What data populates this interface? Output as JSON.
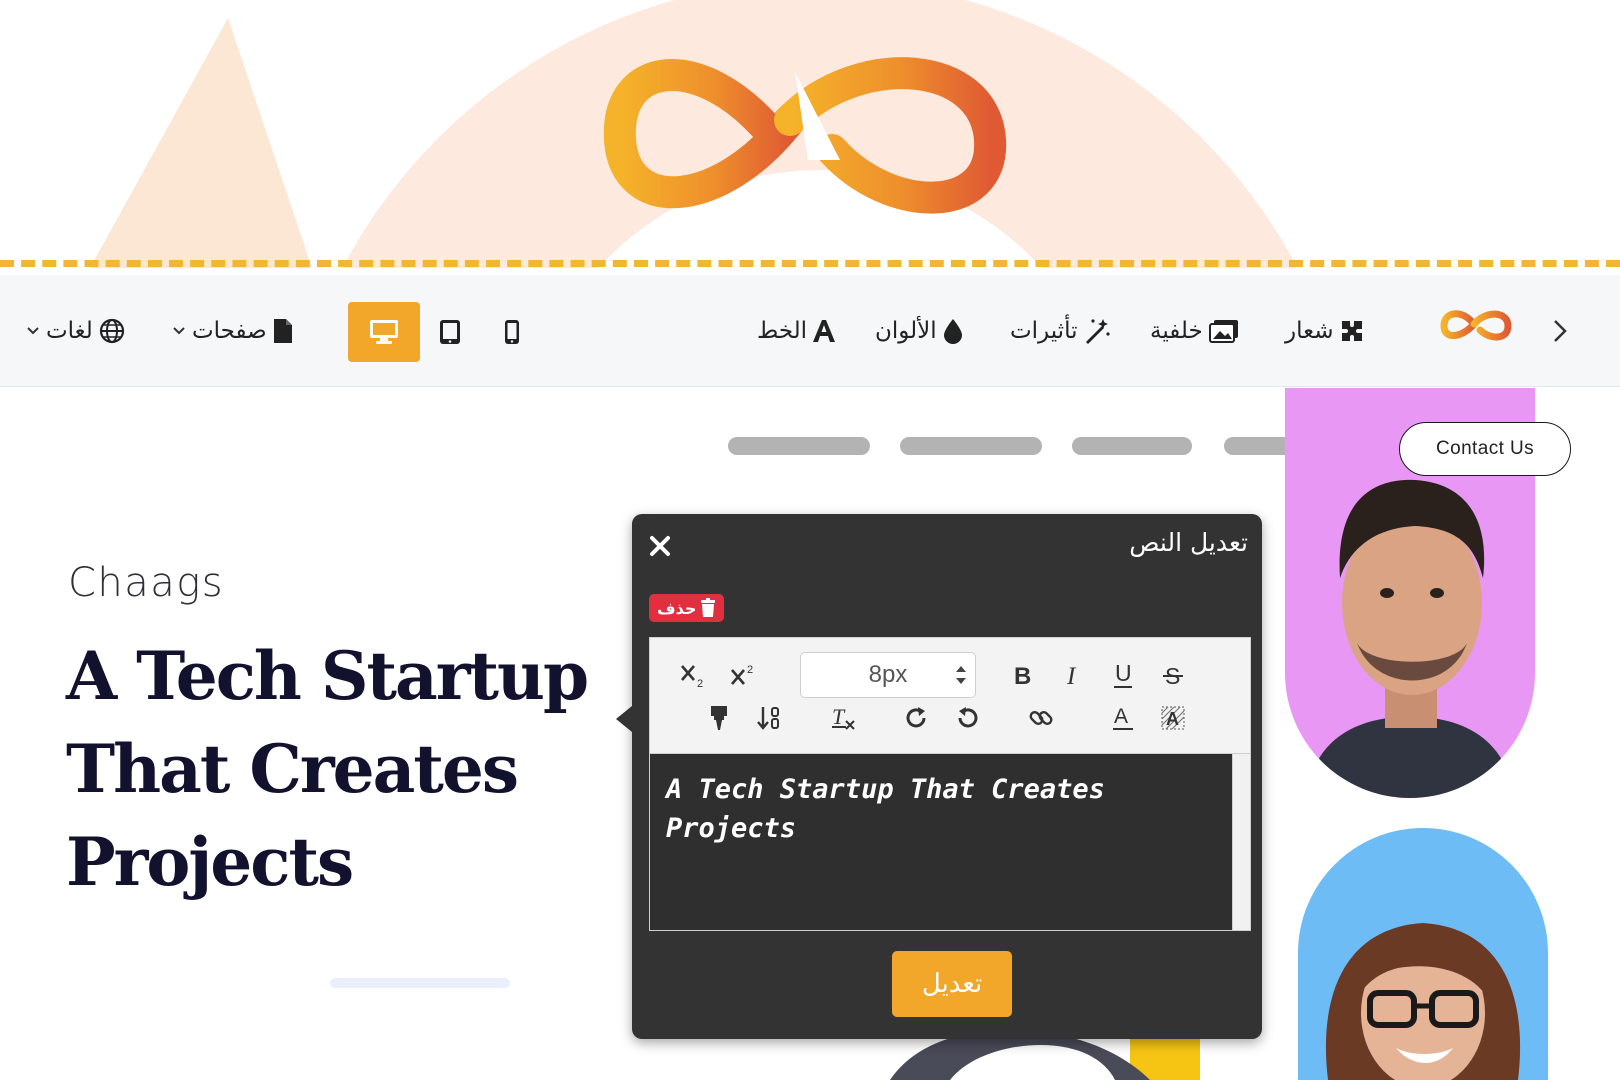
{
  "colors": {
    "accent": "#f2a62a",
    "dialog_bg": "#333333",
    "danger": "#e0303f",
    "heading": "#13122e",
    "purple_card": "#e898f4",
    "blue_card": "#6ebcf5",
    "dash": "#f2b632"
  },
  "toolbar": {
    "nav_icon": "chevron-right-icon",
    "items": [
      {
        "label": "شعار",
        "icon": "puzzle-icon"
      },
      {
        "label": "خلفية",
        "icon": "image-icon"
      },
      {
        "label": "تأثيرات",
        "icon": "magic-wand-icon"
      },
      {
        "label": "الألوان",
        "icon": "droplet-icon"
      },
      {
        "label": "الخط",
        "icon": "font-icon"
      }
    ],
    "devices": {
      "active": "desktop",
      "list": [
        "desktop",
        "tablet",
        "mobile"
      ]
    },
    "pages_label": "صفحات",
    "languages_label": "لغات"
  },
  "site": {
    "contact_label": "Contact Us",
    "brand": "Chaags",
    "headline": "A Tech Startup That Creates Projects"
  },
  "dialog": {
    "title": "تعديل النص",
    "delete_label": "حذف",
    "font_size": "8px",
    "content": "A Tech Startup That Creates Projects",
    "submit_label": "تعديل"
  }
}
